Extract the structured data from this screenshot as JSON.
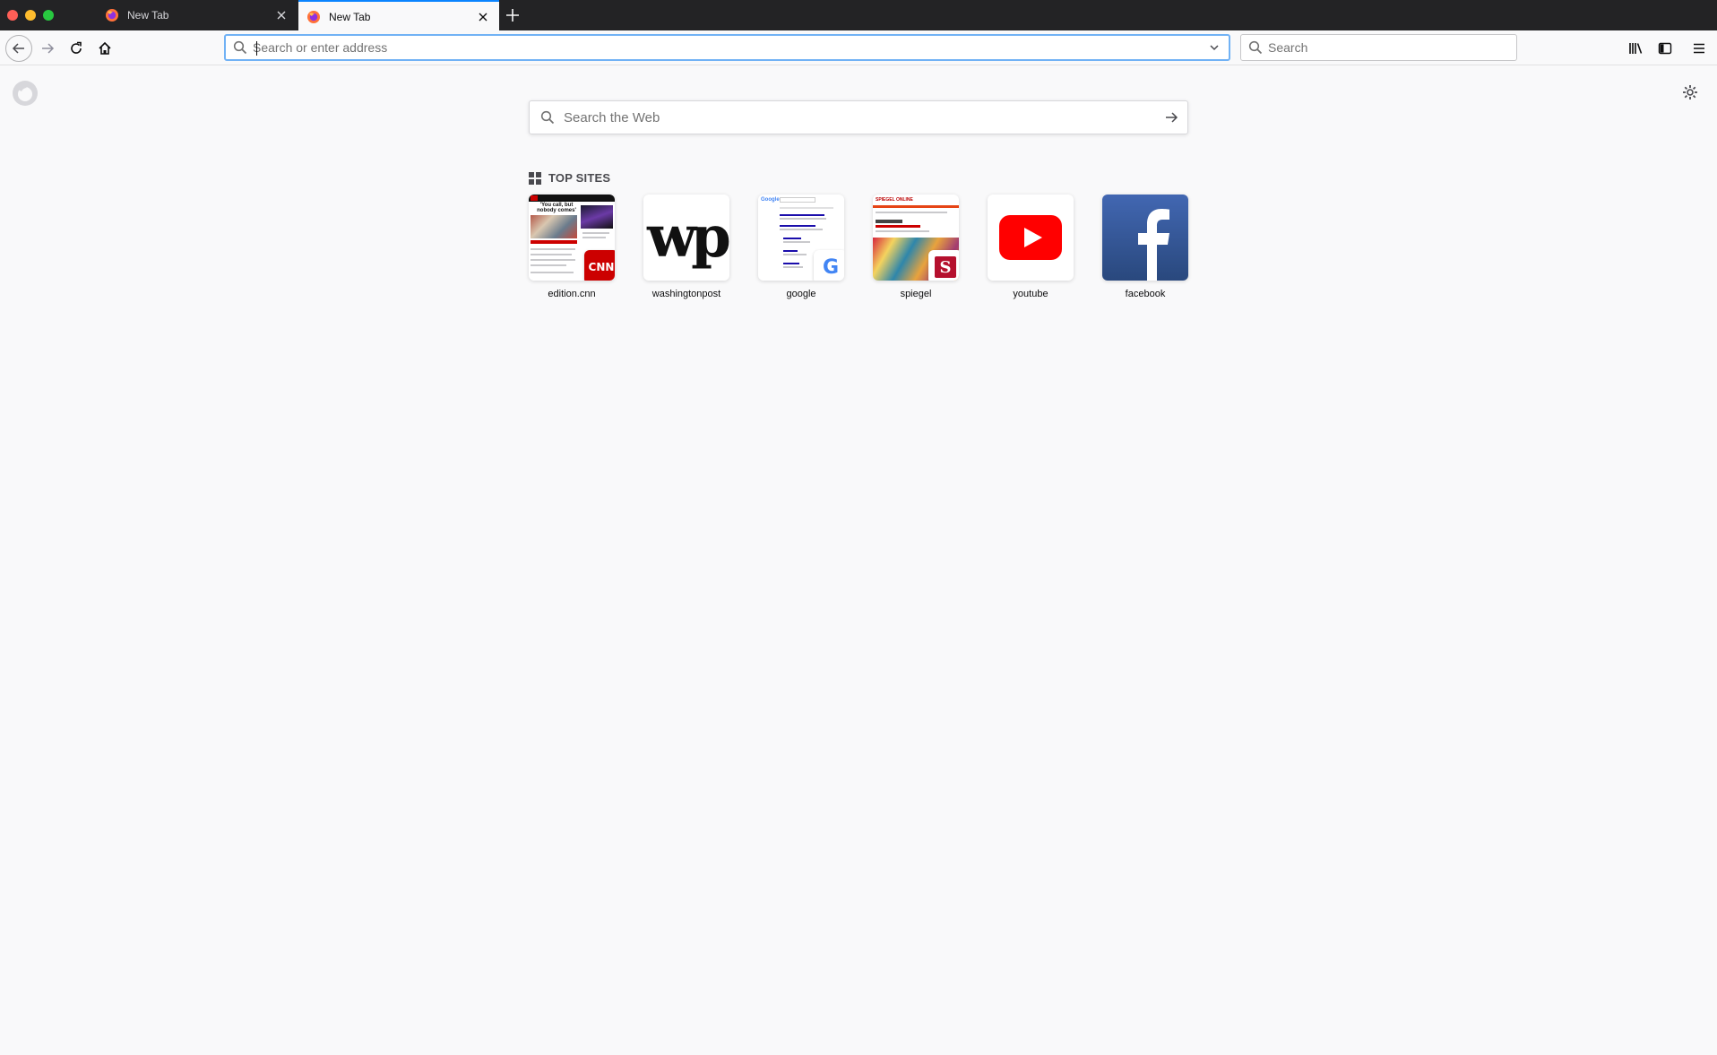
{
  "window": {
    "tabs": [
      {
        "title": "New Tab",
        "active": false
      },
      {
        "title": "New Tab",
        "active": true
      }
    ]
  },
  "toolbar": {
    "url_placeholder": "Search or enter address",
    "search_placeholder": "Search"
  },
  "page": {
    "web_search_placeholder": "Search the Web",
    "top_sites_title": "TOP SITES",
    "thumb_text": {
      "cnn_headline": "'You call, but nobody comes'",
      "cnn_logo": "CNN",
      "wapo_logo": "wp",
      "google_logo": "Google",
      "google_badge": "G",
      "spiegel_masthead": "SPIEGEL ONLINE",
      "spiegel_badge": "S"
    },
    "top_sites": [
      {
        "label": "edition.cnn",
        "icon": "cnn-thumbnail"
      },
      {
        "label": "washingtonpost",
        "icon": "wapo-logo"
      },
      {
        "label": "google",
        "icon": "google-thumbnail"
      },
      {
        "label": "spiegel",
        "icon": "spiegel-thumbnail"
      },
      {
        "label": "youtube",
        "icon": "youtube-logo"
      },
      {
        "label": "facebook",
        "icon": "facebook-logo"
      }
    ]
  },
  "colors": {
    "accent": "#0a84ff",
    "youtube_red": "#ff0000",
    "facebook_blue": "#3b5998"
  }
}
